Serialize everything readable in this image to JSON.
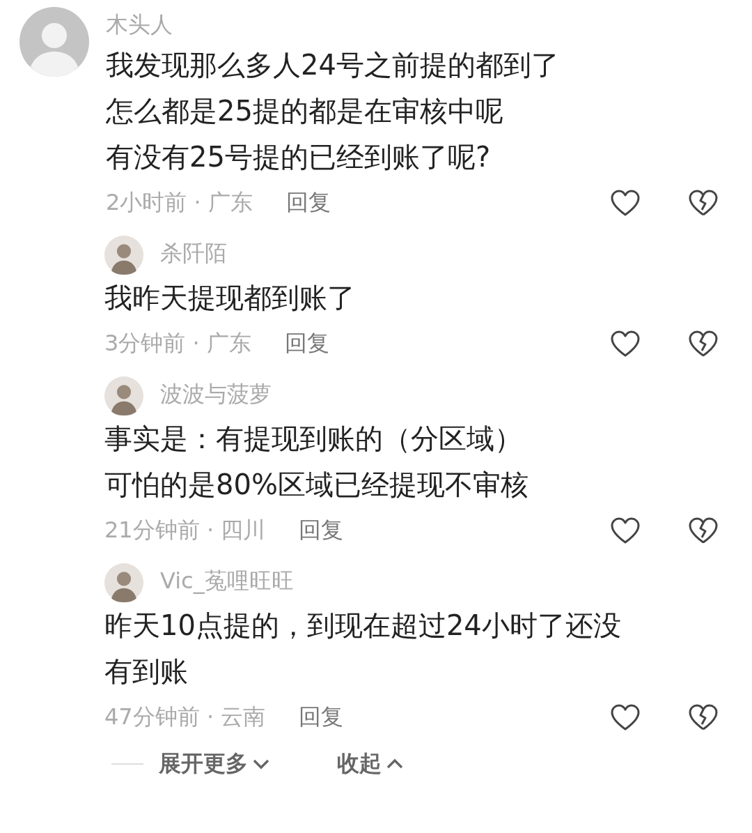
{
  "comment": {
    "avatar": {
      "kind": "default"
    },
    "name": "木头人",
    "lines": [
      "我发现那么多人24号之前提的都到了",
      "怎么都是25提的都是在审核中呢",
      "有没有25号提的已经到账了呢?"
    ],
    "time": "2小时前 · 广东",
    "reply": "回复",
    "replies": [
      {
        "avatar": {
          "kind": "photo"
        },
        "name": "杀阡陌",
        "lines": [
          "我昨天提现都到账了"
        ],
        "time": "3分钟前 · 广东",
        "reply": "回复"
      },
      {
        "avatar": {
          "kind": "photo"
        },
        "name": "波波与菠萝",
        "lines": [
          "事实是：有提现到账的（分区域）",
          "可怕的是80%区域已经提现不审核"
        ],
        "time": "21分钟前 · 四川",
        "reply": "回复"
      },
      {
        "avatar": {
          "kind": "photo"
        },
        "name": "Vic_菟哩旺旺",
        "lines": [
          "昨天10点提的，到现在超过24小时了还没",
          "有到账"
        ],
        "time": "47分钟前 · 云南",
        "reply": "回复"
      }
    ]
  },
  "footer": {
    "expand": "展开更多",
    "collapse": "收起"
  }
}
